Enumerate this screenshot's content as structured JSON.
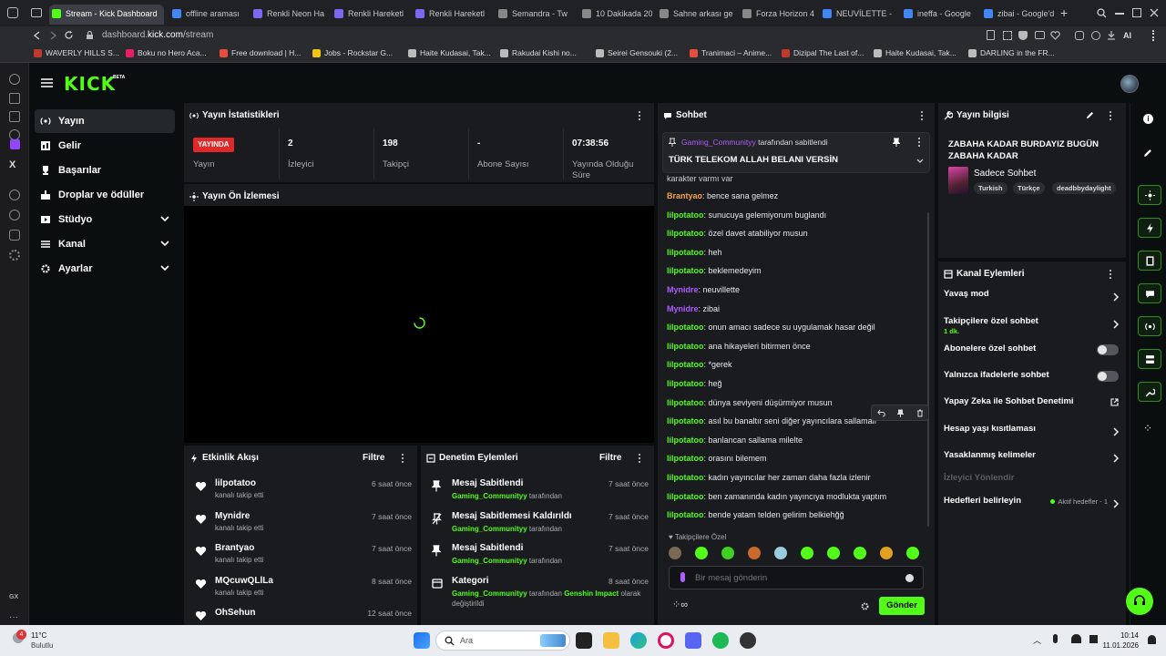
{
  "browser": {
    "tabs": [
      {
        "label": "Stream - Kick Dashboard",
        "color": "#53fc18",
        "active": true
      },
      {
        "label": "offline araması",
        "color": "#4285f4"
      },
      {
        "label": "Renkli Neon Ha",
        "color": "#7b68ee"
      },
      {
        "label": "Renkli Hareketl",
        "color": "#7b68ee"
      },
      {
        "label": "Renkli Hareketl",
        "color": "#7b68ee"
      },
      {
        "label": "Semandra - Tw",
        "color": "#888888"
      },
      {
        "label": "10 Dakikada 20",
        "color": "#888888"
      },
      {
        "label": "Sahne arkası ge",
        "color": "#888888"
      },
      {
        "label": "Forza Horizon 4",
        "color": "#888888"
      },
      {
        "label": "NEUVİLETTE -",
        "color": "#4285f4"
      },
      {
        "label": "ineffa - Google",
        "color": "#4285f4"
      },
      {
        "label": "zibai - Google'd",
        "color": "#4285f4"
      }
    ],
    "url_prefix": "dashboard.",
    "url_domain": "kick.com",
    "url_path": "/stream",
    "ai_label": "AI",
    "bookmarks": [
      {
        "label": "WAVERLY HILLS S...",
        "color": "#c0392b"
      },
      {
        "label": "Boku no Hero Aca...",
        "color": "#e91e63"
      },
      {
        "label": "Free download | H...",
        "color": "#e74c3c"
      },
      {
        "label": "Jobs - Rockstar G...",
        "color": "#f1c40f"
      },
      {
        "label": "Haite Kudasai, Tak...",
        "color": "#bbbbbb"
      },
      {
        "label": "Rakudai Kishi no...",
        "color": "#bbbbbb"
      },
      {
        "label": "Seirei Gensouki (2...",
        "color": "#bbbbbb"
      },
      {
        "label": "Tranimaci – Anime...",
        "color": "#e74c3c"
      },
      {
        "label": "Dizipal The Last of...",
        "color": "#c0392b"
      },
      {
        "label": "Haite Kudasai, Tak...",
        "color": "#bbbbbb"
      },
      {
        "label": "DARLING in the FR...",
        "color": "#bbbbbb"
      }
    ],
    "side_label": "GX"
  },
  "kick": {
    "accent": "#53fc18",
    "logo": "KICK",
    "logo_sup": "BETA",
    "nav": [
      {
        "label": "Yayın",
        "icon": "broadcast-icon",
        "active": true
      },
      {
        "label": "Gelir",
        "icon": "revenue-icon"
      },
      {
        "label": "Başarılar",
        "icon": "trophy-icon"
      },
      {
        "label": "Droplar ve ödüller",
        "icon": "drops-icon"
      },
      {
        "label": "Stüdyo",
        "icon": "studio-icon",
        "expandable": true
      },
      {
        "label": "Kanal",
        "icon": "channel-icon",
        "expandable": true
      },
      {
        "label": "Ayarlar",
        "icon": "settings-icon",
        "expandable": true
      }
    ],
    "stats": {
      "title": "Yayın İstatistikleri",
      "live_badge": "YAYINDA",
      "items": [
        {
          "value": "",
          "label": "Yayın"
        },
        {
          "value": "2",
          "label": "İzleyici"
        },
        {
          "value": "198",
          "label": "Takipçi"
        },
        {
          "value": "-",
          "label": "Abone Sayısı"
        },
        {
          "value": "07:38:56",
          "label": "Yayında Olduğu Süre"
        }
      ]
    },
    "preview": {
      "title": "Yayın Ön İzlemesi"
    },
    "activity": {
      "title": "Etkinlik Akışı",
      "filter": "Filtre",
      "items": [
        {
          "name": "lilpotatoo",
          "sub": "kanalı takip etti",
          "time": "6 saat önce"
        },
        {
          "name": "Mynidre",
          "sub": "kanalı takip etti",
          "time": "7 saat önce"
        },
        {
          "name": "Brantyao",
          "sub": "kanalı takip etti",
          "time": "7 saat önce"
        },
        {
          "name": "MQcuwQLlLa",
          "sub": "kanalı takip etti",
          "time": "8 saat önce"
        },
        {
          "name": "OhSehun",
          "sub": "",
          "time": "12 saat önce"
        }
      ]
    },
    "moderation": {
      "title": "Denetim Eylemleri",
      "filter": "Filtre",
      "items": [
        {
          "name": "Mesaj Sabitlendi",
          "user": "Gaming_Communityy",
          "rest": "tarafından",
          "time": "7 saat önce",
          "icon": "pin-icon"
        },
        {
          "name": "Mesaj Sabitlemesi Kaldırıldı",
          "user": "Gaming_Communityy",
          "rest": "tarafından",
          "time": "7 saat önce",
          "icon": "unpin-icon"
        },
        {
          "name": "Mesaj Sabitlendi",
          "user": "Gaming_Communityy",
          "rest": "tarafından",
          "time": "7 saat önce",
          "icon": "pin-icon"
        },
        {
          "name": "Kategori",
          "user": "Gaming_Communityy",
          "rest": "tarafından",
          "game": "Genshin Impact",
          "rest2": "olarak değiştirildi",
          "time": "8 saat önce",
          "icon": "category-icon"
        }
      ]
    },
    "chat": {
      "title": "Sohbet",
      "pinned_by_user": "Gaming_Communityy",
      "pinned_by_text": "tarafından sabitlendi",
      "pinned_message": "TÜRK TELEKOM ALLAH BELANI VERSİN",
      "partial_line": "karakter varmı var",
      "messages": [
        {
          "user": "Brantyao",
          "text": "bence sana gelmez",
          "color": "#f5a04a"
        },
        {
          "user": "lilpotatoo",
          "text": "sunucuya gelemiyorum buglandı",
          "color": "#53fc18"
        },
        {
          "user": "lilpotatoo",
          "text": "özel davet atabiliyor musun",
          "color": "#53fc18"
        },
        {
          "user": "lilpotatoo",
          "text": "heh",
          "color": "#53fc18"
        },
        {
          "user": "lilpotatoo",
          "text": "beklemedeyim",
          "color": "#53fc18"
        },
        {
          "user": "Mynidre",
          "text": "neuvillette",
          "color": "#b05cff"
        },
        {
          "user": "Mynidre",
          "text": "zibai",
          "color": "#b05cff"
        },
        {
          "user": "lilpotatoo",
          "text": "onun amacı sadece su uygulamak hasar değil",
          "color": "#53fc18"
        },
        {
          "user": "lilpotatoo",
          "text": "ana hikayeleri bitirmen önce",
          "color": "#53fc18"
        },
        {
          "user": "lilpotatoo",
          "text": "*gerek",
          "color": "#53fc18"
        },
        {
          "user": "lilpotatoo",
          "text": "heğ",
          "color": "#53fc18"
        },
        {
          "user": "lilpotatoo",
          "text": "dünya seviyeni düşürmiyor musun",
          "color": "#53fc18"
        },
        {
          "user": "lilpotatoo",
          "text": "asıl bu banaltır seni diğer yayıncılara sallamalı",
          "color": "#53fc18"
        },
        {
          "user": "lilpotatoo",
          "text": "banlancan sallama milelte",
          "color": "#53fc18"
        },
        {
          "user": "lilpotatoo",
          "text": "orasını bilemem",
          "color": "#53fc18"
        },
        {
          "user": "lilpotatoo",
          "text": "kadın yayıncılar her zaman daha fazla izlenir",
          "color": "#53fc18"
        },
        {
          "user": "lilpotatoo",
          "text": "ben zamanında kadın yayıncıya modlukta yaptım",
          "color": "#53fc18"
        },
        {
          "user": "lilpotatoo",
          "text": "bende yatam telden gelirim belkiehğğ",
          "color": "#53fc18"
        }
      ],
      "followers_only_label": "Takipçilere Özel",
      "input_placeholder": "Bir mesaj gönderin",
      "send_label": "Gönder"
    },
    "stream_info": {
      "title": "Yayın bilgisi",
      "stream_title": "ZABAHA KADAR BURDAYIZ BUGÜN ZABAHA KADAR",
      "category": "Sadece Sohbet",
      "tags": [
        "Turkish",
        "Türkçe",
        "deadbbydaylight"
      ]
    },
    "channel_actions": {
      "title": "Kanal Eylemleri",
      "items": [
        {
          "label": "Yavaş mod",
          "type": "chevron"
        },
        {
          "label": "Takipçilere özel sohbet",
          "sub": "1 dk.",
          "type": "chevron"
        },
        {
          "label": "Abonelere özel sohbet",
          "type": "toggle"
        },
        {
          "label": "Yalnızca ifadelerle sohbet",
          "type": "toggle"
        },
        {
          "label": "Yapay Zeka ile Sohbet Denetimi",
          "type": "external"
        },
        {
          "label": "Hesap yaşı kısıtlaması",
          "type": "chevron"
        },
        {
          "label": "Yasaklanmış kelimeler",
          "type": "chevron"
        },
        {
          "label": "İzleyici Yönlendir",
          "type": "disabled"
        },
        {
          "label": "Hedefleri belirleyin",
          "type": "goal",
          "badge": "Aktif hedefler - 1"
        }
      ]
    }
  },
  "taskbar": {
    "weather_temp": "11°C",
    "weather_desc": "Bulutlu",
    "notif_count": "4",
    "search_placeholder": "Ara",
    "time": "10:14",
    "date": "11.01.2026"
  }
}
